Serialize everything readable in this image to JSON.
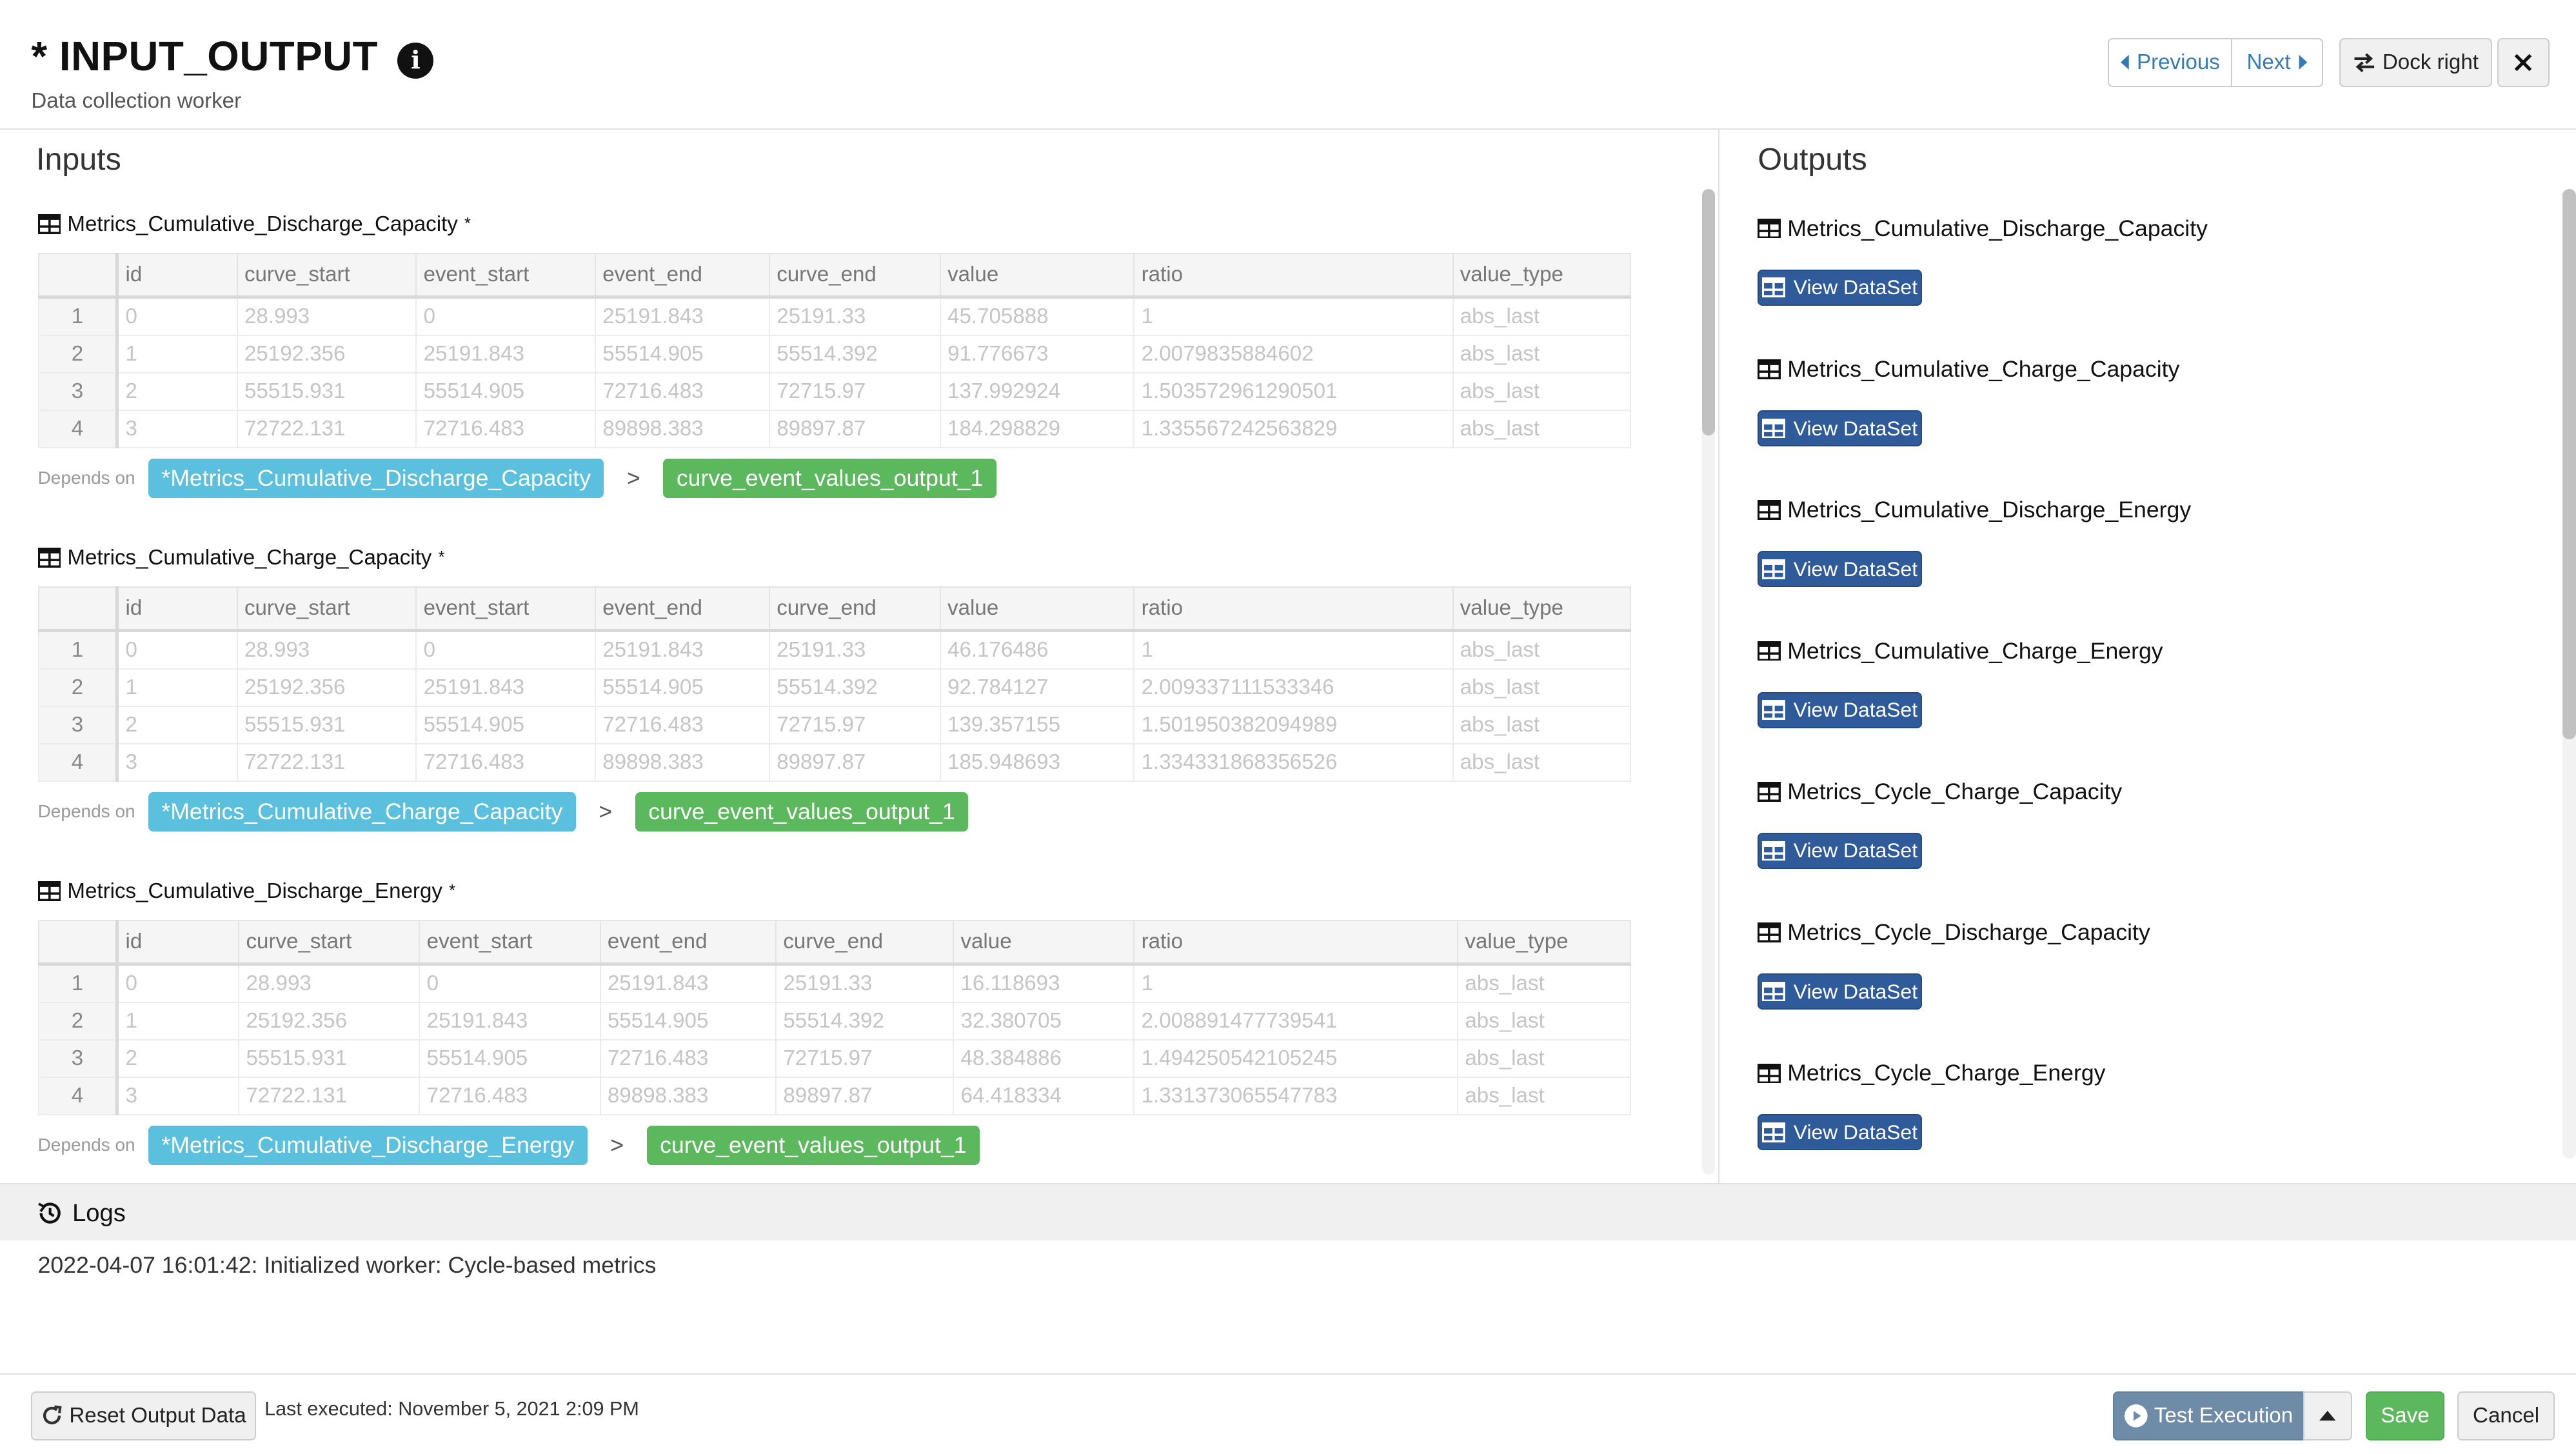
{
  "header": {
    "title": "* INPUT_OUTPUT",
    "subtitle": "Data collection worker",
    "previous_label": "Previous",
    "next_label": "Next",
    "dock_label": "Dock right"
  },
  "inputs": {
    "title": "Inputs",
    "depends_label": "Depends on",
    "datasets": [
      {
        "name": "Metrics_Cumulative_Discharge_Capacity",
        "marker": "*",
        "columns": [
          "id",
          "curve_start",
          "event_start",
          "event_end",
          "curve_end",
          "value",
          "ratio",
          "value_type"
        ],
        "rows": [
          [
            "1",
            "0",
            "28.993",
            "0",
            "25191.843",
            "25191.33",
            "45.705888",
            "1",
            "abs_last"
          ],
          [
            "2",
            "1",
            "25192.356",
            "25191.843",
            "55514.905",
            "55514.392",
            "91.776673",
            "2.0079835884602",
            "abs_last"
          ],
          [
            "3",
            "2",
            "55515.931",
            "55514.905",
            "72716.483",
            "72715.97",
            "137.992924",
            "1.503572961290501",
            "abs_last"
          ],
          [
            "4",
            "3",
            "72722.131",
            "72716.483",
            "89898.383",
            "89897.87",
            "184.298829",
            "1.335567242563829",
            "abs_last"
          ]
        ],
        "depends_tag": "*Metrics_Cumulative_Discharge_Capacity",
        "output_tag": "curve_event_values_output_1"
      },
      {
        "name": "Metrics_Cumulative_Charge_Capacity",
        "marker": "*",
        "columns": [
          "id",
          "curve_start",
          "event_start",
          "event_end",
          "curve_end",
          "value",
          "ratio",
          "value_type"
        ],
        "rows": [
          [
            "1",
            "0",
            "28.993",
            "0",
            "25191.843",
            "25191.33",
            "46.176486",
            "1",
            "abs_last"
          ],
          [
            "2",
            "1",
            "25192.356",
            "25191.843",
            "55514.905",
            "55514.392",
            "92.784127",
            "2.009337111533346",
            "abs_last"
          ],
          [
            "3",
            "2",
            "55515.931",
            "55514.905",
            "72716.483",
            "72715.97",
            "139.357155",
            "1.501950382094989",
            "abs_last"
          ],
          [
            "4",
            "3",
            "72722.131",
            "72716.483",
            "89898.383",
            "89897.87",
            "185.948693",
            "1.334331868356526",
            "abs_last"
          ]
        ],
        "depends_tag": "*Metrics_Cumulative_Charge_Capacity",
        "output_tag": "curve_event_values_output_1"
      },
      {
        "name": "Metrics_Cumulative_Discharge_Energy",
        "marker": "*",
        "columns": [
          "id",
          "curve_start",
          "event_start",
          "event_end",
          "curve_end",
          "value",
          "ratio",
          "value_type"
        ],
        "rows": [
          [
            "1",
            "0",
            "28.993",
            "0",
            "25191.843",
            "25191.33",
            "16.118693",
            "1",
            "abs_last"
          ],
          [
            "2",
            "1",
            "25192.356",
            "25191.843",
            "55514.905",
            "55514.392",
            "32.380705",
            "2.008891477739541",
            "abs_last"
          ],
          [
            "3",
            "2",
            "55515.931",
            "55514.905",
            "72716.483",
            "72715.97",
            "48.384886",
            "1.494250542105245",
            "abs_last"
          ],
          [
            "4",
            "3",
            "72722.131",
            "72716.483",
            "89898.383",
            "89897.87",
            "64.418334",
            "1.331373065547783",
            "abs_last"
          ]
        ],
        "depends_tag": "*Metrics_Cumulative_Discharge_Energy",
        "output_tag": "curve_event_values_output_1"
      }
    ]
  },
  "outputs": {
    "title": "Outputs",
    "view_label": "View DataSet",
    "items": [
      "Metrics_Cumulative_Discharge_Capacity",
      "Metrics_Cumulative_Charge_Capacity",
      "Metrics_Cumulative_Discharge_Energy",
      "Metrics_Cumulative_Charge_Energy",
      "Metrics_Cycle_Charge_Capacity",
      "Metrics_Cycle_Discharge_Capacity",
      "Metrics_Cycle_Charge_Energy"
    ]
  },
  "logs": {
    "label": "Logs",
    "entries": [
      "2022-04-07 16:01:42: Initialized worker: Cycle-based metrics"
    ]
  },
  "footer": {
    "reset_label": "Reset Output Data",
    "last_executed": "Last executed: November 5, 2021 2:09 PM",
    "test_label": "Test Execution",
    "save_label": "Save",
    "cancel_label": "Cancel"
  },
  "colors": {
    "tag_blue": "#5bc0de",
    "tag_green": "#5cb85c",
    "view_button": "#2f5b9a",
    "test_button": "#6e8ba7",
    "save_button": "#5cb85c"
  }
}
